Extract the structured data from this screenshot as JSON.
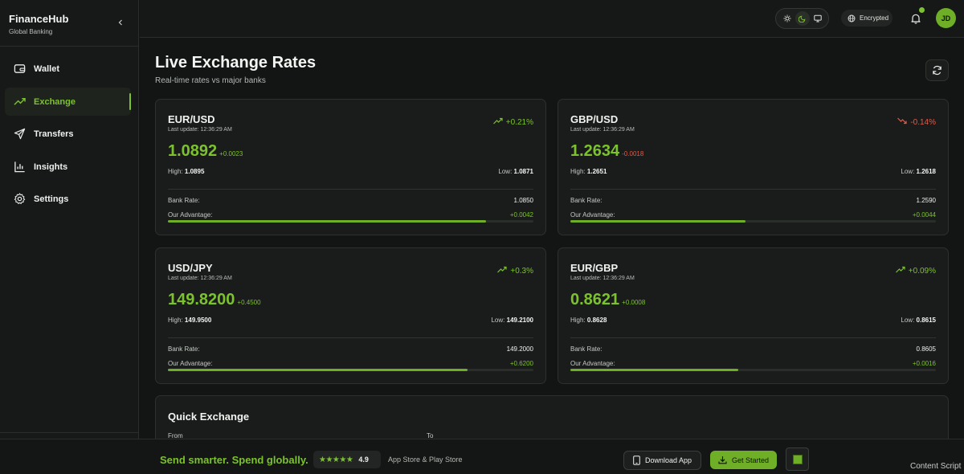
{
  "brand": {
    "title": "FinanceHub",
    "subtitle": "Global Banking"
  },
  "sidebar": {
    "items": [
      {
        "label": "Wallet",
        "icon": "wallet-icon",
        "active": false
      },
      {
        "label": "Exchange",
        "icon": "trending-up-icon",
        "active": true
      },
      {
        "label": "Transfers",
        "icon": "send-icon",
        "active": false
      },
      {
        "label": "Insights",
        "icon": "bar-chart-icon",
        "active": false
      },
      {
        "label": "Settings",
        "icon": "gear-icon",
        "active": false
      }
    ]
  },
  "header": {
    "theme_options": [
      "sun-icon",
      "moon-icon",
      "monitor-icon"
    ],
    "theme_active": "moon-icon",
    "encrypted_label": "Encrypted",
    "avatar_initials": "JD"
  },
  "main": {
    "title": "Live Exchange Rates",
    "subtitle": "Real-time rates vs major banks"
  },
  "labels": {
    "high": "High:",
    "low": "Low:",
    "bank_rate": "Bank Rate:",
    "our_advantage": "Our Advantage:"
  },
  "rates": [
    {
      "pair": "EUR/USD",
      "last_update": "Last update: 12:36:29 AM",
      "change": "+0.21%",
      "direction": "up",
      "rate": "1.0892",
      "delta": "+0.0023",
      "high": "1.0895",
      "low": "1.0871",
      "bank_rate": "1.0850",
      "advantage": "+0.0042",
      "advantage_fill": 0.87
    },
    {
      "pair": "GBP/USD",
      "last_update": "Last update: 12:36:29 AM",
      "change": "-0.14%",
      "direction": "down",
      "rate": "1.2634",
      "delta": "-0.0018",
      "high": "1.2651",
      "low": "1.2618",
      "bank_rate": "1.2590",
      "advantage": "+0.0044",
      "advantage_fill": 0.48
    },
    {
      "pair": "USD/JPY",
      "last_update": "Last update: 12:36:29 AM",
      "change": "+0.3%",
      "direction": "up",
      "rate": "149.8200",
      "delta": "+0.4500",
      "high": "149.9500",
      "low": "149.2100",
      "bank_rate": "149.2000",
      "advantage": "+0.6200",
      "advantage_fill": 0.82
    },
    {
      "pair": "EUR/GBP",
      "last_update": "Last update: 12:36:29 AM",
      "change": "+0.09%",
      "direction": "up",
      "rate": "0.8621",
      "delta": "+0.0008",
      "high": "0.8628",
      "low": "0.8615",
      "bank_rate": "0.8605",
      "advantage": "+0.0016",
      "advantage_fill": 0.46
    }
  ],
  "quick_exchange": {
    "title": "Quick Exchange",
    "from_label": "From",
    "to_label": "To"
  },
  "banner": {
    "slogan": "Send smarter. Spend globally.",
    "stars": "★★★★★",
    "rating": "4.9",
    "store_text": "App Store & Play Store",
    "download_label": "Download App",
    "get_started_label": "Get Started",
    "content_script": "Content Script"
  },
  "colors": {
    "accent": "#7cc22e",
    "negative": "#e35a48",
    "background": "#131514"
  }
}
